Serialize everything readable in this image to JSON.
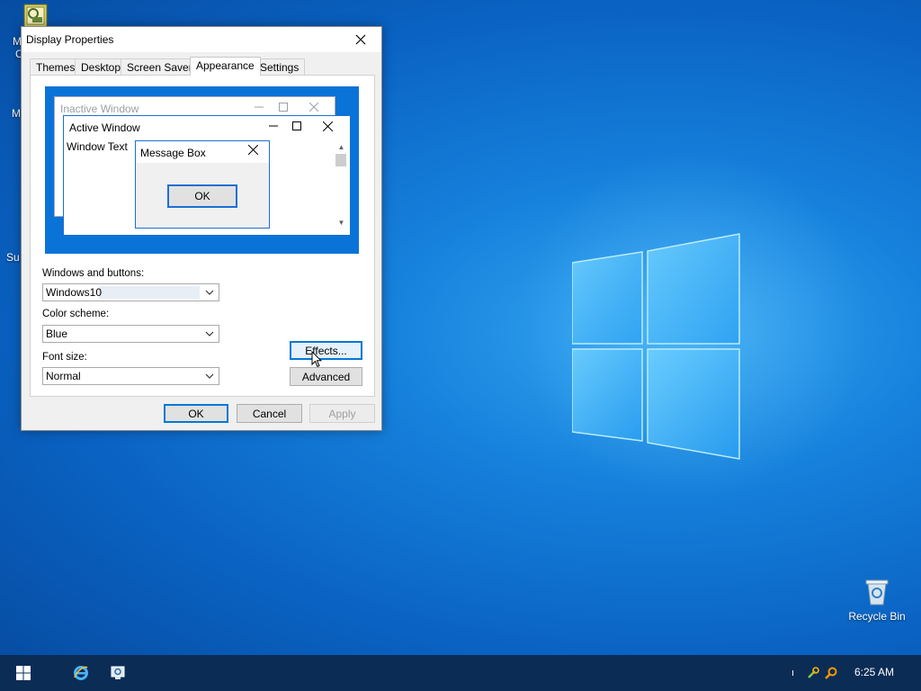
{
  "desktop": {
    "recycle_bin_label": "Recycle Bin",
    "left_stubs": [
      "M",
      "C",
      "M",
      "Su"
    ]
  },
  "dialog": {
    "title": "Display Properties",
    "tabs": [
      {
        "label": "Themes",
        "active": false
      },
      {
        "label": "Desktop",
        "active": false
      },
      {
        "label": "Screen Saver",
        "active": false
      },
      {
        "label": "Appearance",
        "active": true
      },
      {
        "label": "Settings",
        "active": false
      }
    ],
    "preview": {
      "inactive_title": "Inactive Window",
      "active_title": "Active Window",
      "window_text": "Window Text",
      "message_box_title": "Message Box",
      "message_box_ok": "OK"
    },
    "windows_and_buttons": {
      "label": "Windows and buttons:",
      "value": "Windows10"
    },
    "color_scheme": {
      "label": "Color scheme:",
      "value": "Blue"
    },
    "font_size": {
      "label": "Font size:",
      "value": "Normal"
    },
    "effects_label": "Effects...",
    "advanced_label": "Advanced",
    "ok_label": "OK",
    "cancel_label": "Cancel",
    "apply_label": "Apply"
  },
  "taskbar": {
    "clock": "6:25 AM",
    "tray_stub": "ı"
  },
  "colors": {
    "accent": "#0078d7",
    "taskbar": "#0b2c55",
    "preview_background": "#0a73d8"
  }
}
